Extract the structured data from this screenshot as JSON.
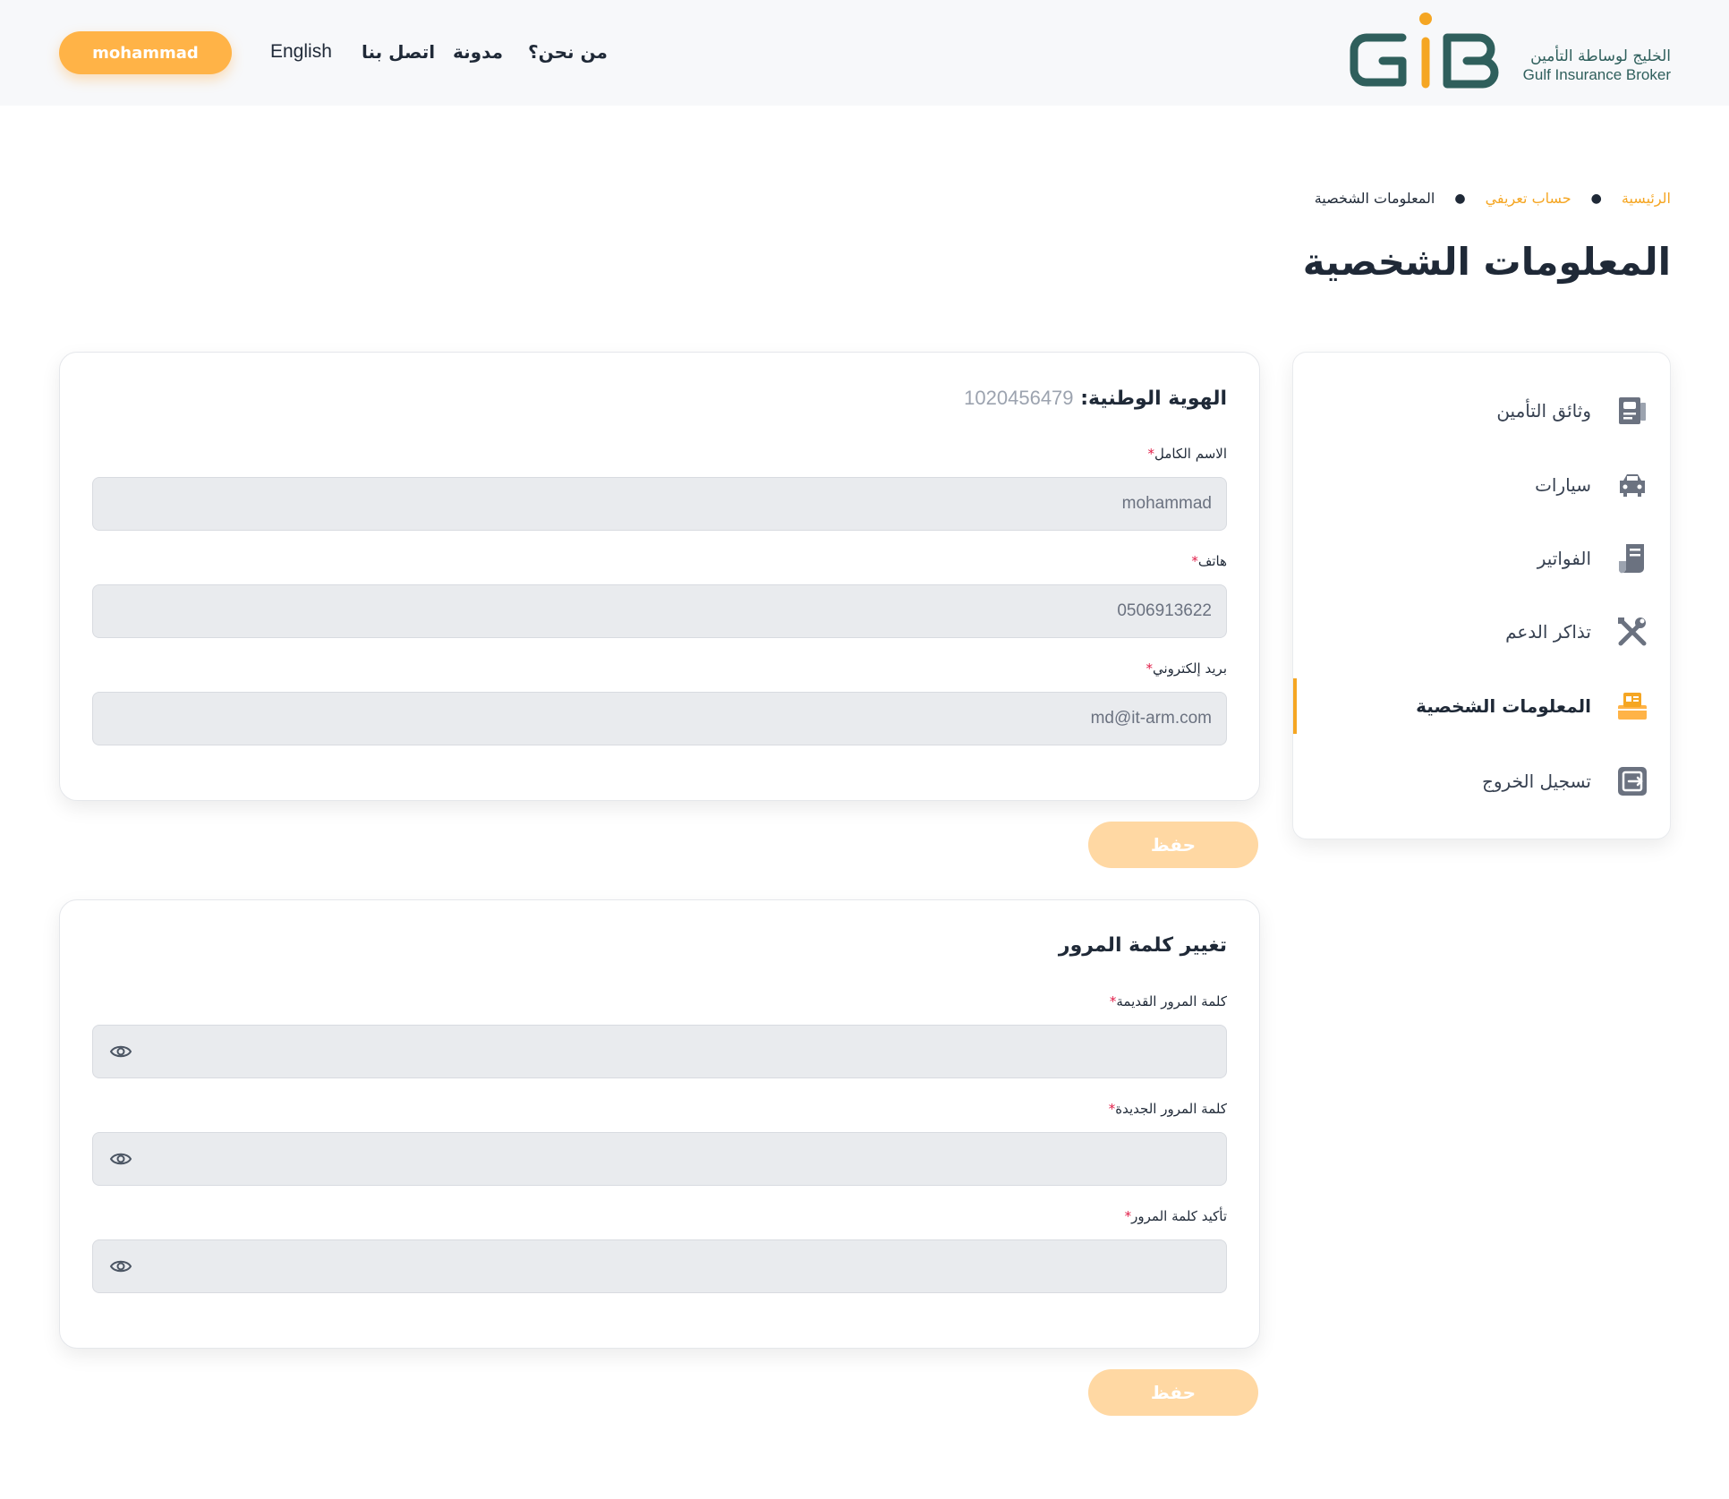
{
  "header": {
    "user_button": "mohammad",
    "nav": {
      "english": "English",
      "contact": "اتصل بنا",
      "blog": "مدونة",
      "about": "من نحن؟"
    },
    "logo": {
      "text_ar": "الخليج لوساطة التأمين",
      "text_en": "Gulf Insurance Broker",
      "brand_colors": [
        "#2f5f5c",
        "#f5a623"
      ]
    }
  },
  "breadcrumb": {
    "home": "الرئيسية",
    "profile": "حساب تعريفي",
    "current": "المعلومات الشخصية"
  },
  "page_title": "المعلومات الشخصية",
  "sidebar": {
    "items": [
      {
        "label": "وثائق التأمين",
        "icon": "document-icon",
        "active": false
      },
      {
        "label": "سيارات",
        "icon": "car-icon",
        "active": false
      },
      {
        "label": "الفواتير",
        "icon": "invoice-icon",
        "active": false
      },
      {
        "label": "تذاكر الدعم",
        "icon": "tools-icon",
        "active": false
      },
      {
        "label": "المعلومات الشخصية",
        "icon": "id-card-icon",
        "active": true
      },
      {
        "label": "تسجيل الخروج",
        "icon": "logout-icon",
        "active": false
      }
    ]
  },
  "personal_info": {
    "national_id_label": "الهوية الوطنية:",
    "national_id_value": "1020456479",
    "full_name_label": "الاسم الكامل",
    "full_name_value": "mohammad",
    "phone_label": "هاتف",
    "phone_value": "0506913622",
    "email_label": "بريد إلكتروني",
    "email_value": "md@it-arm.com",
    "required_mark": "*",
    "save_label": "حفظ"
  },
  "password_change": {
    "title": "تغيير كلمة المرور",
    "old_label": "كلمة المرور القديمة",
    "new_label": "كلمة المرور الجديدة",
    "confirm_label": "تأكيد كلمة المرور",
    "required_mark": "*",
    "save_label": "حفظ"
  },
  "colors": {
    "accent": "#f5a623",
    "button": "#ffb347",
    "button_disabled": "#ffd8a3",
    "input_bg": "#e9ebee"
  }
}
